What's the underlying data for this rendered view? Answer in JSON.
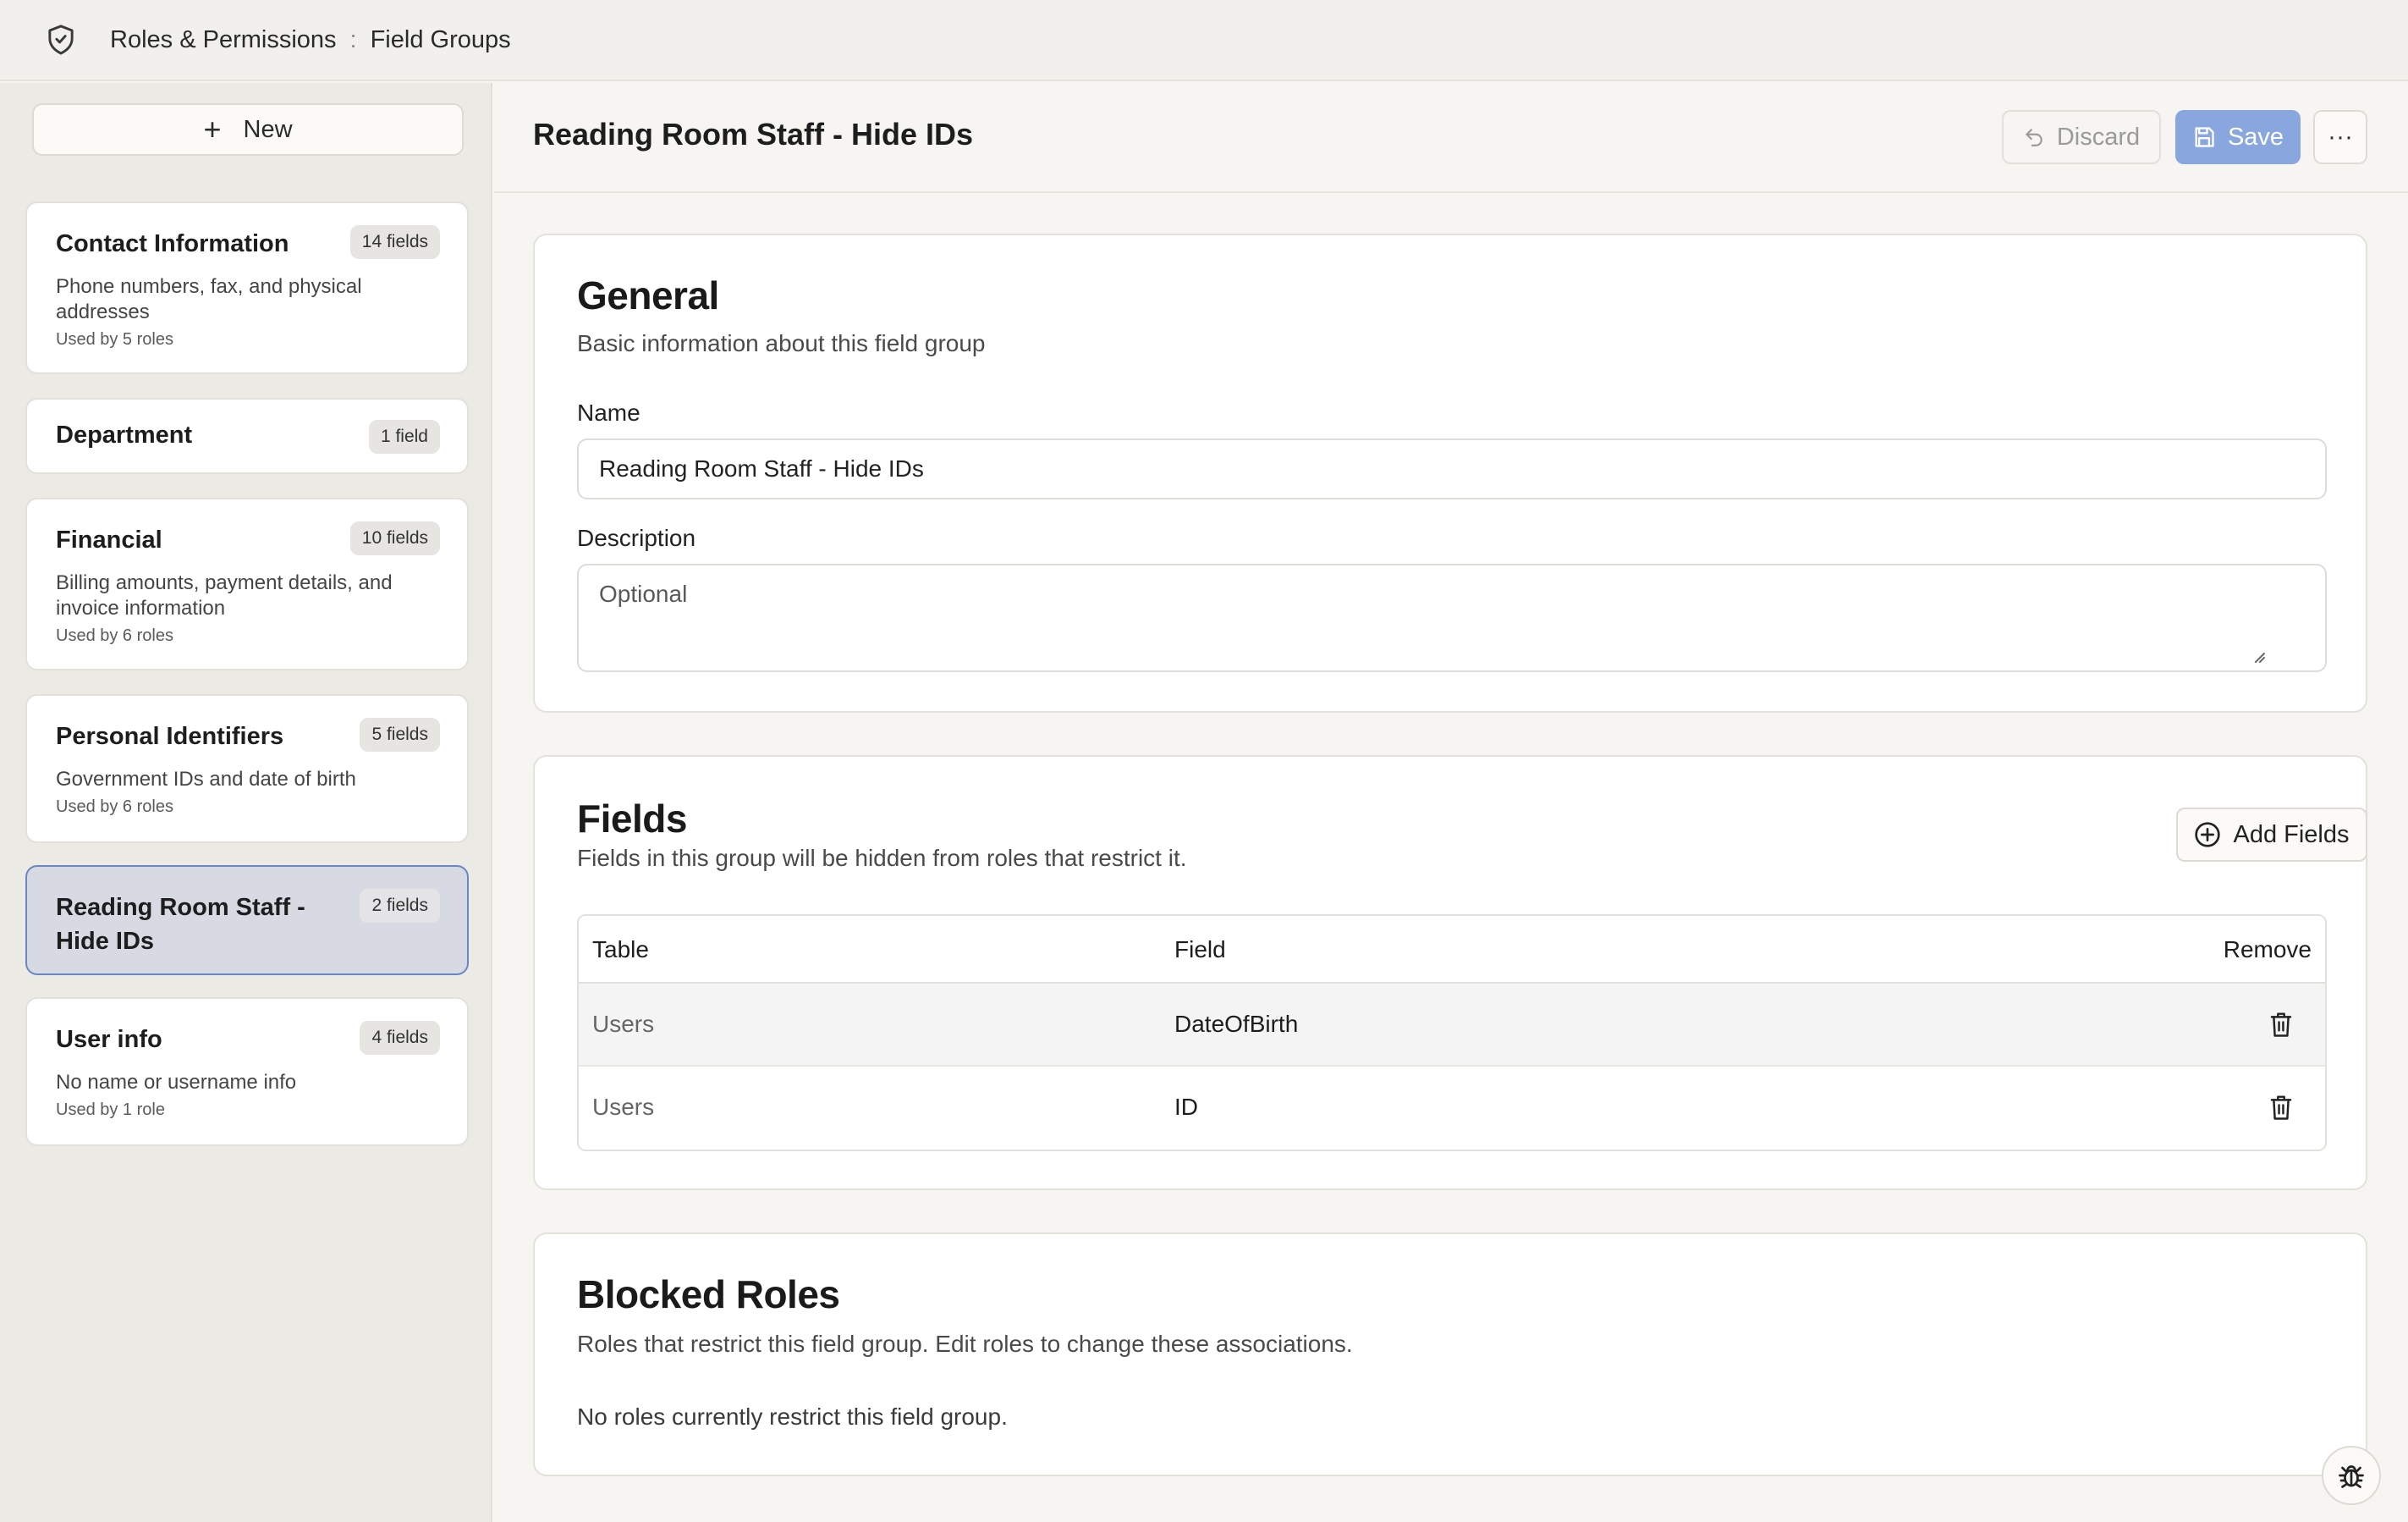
{
  "breadcrumb": {
    "root": "Roles & Permissions",
    "separator": ":",
    "current": "Field Groups"
  },
  "sidebar": {
    "new_label": "New",
    "groups": [
      {
        "title": "Contact Information",
        "badge": "14 fields",
        "description": "Phone numbers, fax, and physical addresses",
        "used_by": "Used by 5 roles"
      },
      {
        "title": "Department",
        "badge": "1 field",
        "description": "",
        "used_by": ""
      },
      {
        "title": "Financial",
        "badge": "10 fields",
        "description": "Billing amounts, payment details, and invoice information",
        "used_by": "Used by 6 roles"
      },
      {
        "title": "Personal Identifiers",
        "badge": "5 fields",
        "description": "Government IDs and date of birth",
        "used_by": "Used by 6 roles"
      },
      {
        "title": "Reading Room Staff - Hide IDs",
        "badge": "2 fields",
        "description": "",
        "used_by": "",
        "selected": true
      },
      {
        "title": "User info",
        "badge": "4 fields",
        "description": "No name or username info",
        "used_by": "Used by 1 role"
      }
    ]
  },
  "header": {
    "title": "Reading Room Staff - Hide IDs",
    "discard_label": "Discard",
    "save_label": "Save",
    "more_label": "···"
  },
  "general": {
    "title": "General",
    "subtitle": "Basic information about this field group",
    "name_label": "Name",
    "name_value": "Reading Room Staff - Hide IDs",
    "description_label": "Description",
    "description_placeholder": "Optional"
  },
  "fields": {
    "title": "Fields",
    "subtitle": "Fields in this group will be hidden from roles that restrict it.",
    "add_label": "Add Fields",
    "columns": [
      "Table",
      "Field",
      "Remove"
    ],
    "rows": [
      {
        "table": "Users",
        "field": "DateOfBirth"
      },
      {
        "table": "Users",
        "field": "ID"
      }
    ]
  },
  "blocked_roles": {
    "title": "Blocked Roles",
    "subtitle": "Roles that restrict this field group. Edit roles to change these associations.",
    "empty_text": "No roles currently restrict this field group."
  },
  "colors": {
    "accent": "#89a6de",
    "selected_card_bg": "#d7dae3",
    "selected_card_border": "#6b86c4"
  },
  "icons": [
    "shield-icon",
    "plus-icon",
    "undo-icon",
    "save-icon",
    "more-icon",
    "add-circle-icon",
    "trash-icon",
    "bug-icon"
  ]
}
